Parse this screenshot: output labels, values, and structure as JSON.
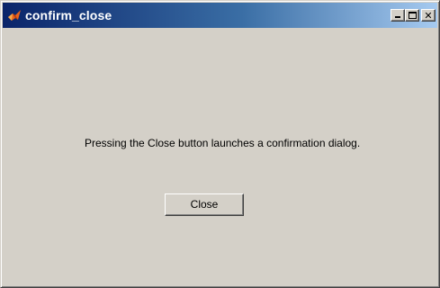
{
  "window": {
    "title": "confirm_close",
    "titlebar_colors": {
      "start": "#0a246a",
      "end": "#a6caf0"
    },
    "face_color": "#d4d0c8",
    "icons": [
      "matlab-icon",
      "minimize-icon",
      "maximize-icon",
      "close-icon"
    ]
  },
  "main": {
    "message": "Pressing the Close button launches a confirmation dialog.",
    "close_button_label": "Close"
  }
}
